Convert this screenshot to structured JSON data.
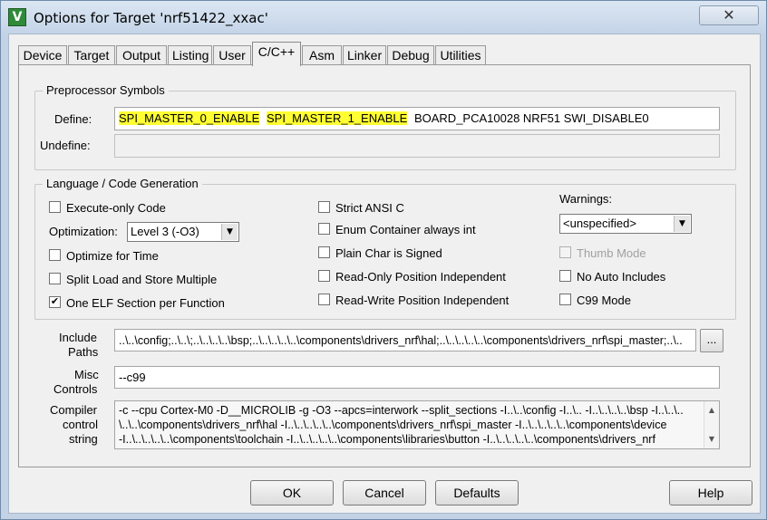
{
  "window": {
    "title": "Options for Target 'nrf51422_xxac'",
    "close_glyph": "✕",
    "icon_glyph": "V"
  },
  "tabs": [
    "Device",
    "Target",
    "Output",
    "Listing",
    "User",
    "C/C++",
    "Asm",
    "Linker",
    "Debug",
    "Utilities"
  ],
  "preprocessor": {
    "title": "Preprocessor Symbols",
    "define_label": "Define:",
    "define_highlight_1": "SPI_MASTER_0_ENABLE",
    "define_highlight_2": "SPI_MASTER_1_ENABLE",
    "define_rest": "BOARD_PCA10028 NRF51 SWI_DISABLE0",
    "undefine_label": "Undefine:",
    "undefine_value": ""
  },
  "language": {
    "title": "Language / Code Generation",
    "execute_only": "Execute-only Code",
    "optimization_label": "Optimization:",
    "optimization_value": "Level 3 (-O3)",
    "optimize_time": "Optimize for Time",
    "split_load": "Split Load and Store Multiple",
    "one_elf": "One ELF Section per Function",
    "strict_ansi": "Strict ANSI C",
    "enum_container": "Enum Container always int",
    "plain_char": "Plain Char is Signed",
    "ro_pi": "Read-Only Position Independent",
    "rw_pi": "Read-Write Position Independent",
    "warnings_label": "Warnings:",
    "warnings_value": "<unspecified>",
    "thumb_mode": "Thumb Mode",
    "no_auto_includes": "No Auto Includes",
    "c99_mode": "C99 Mode",
    "check_glyph": "✔"
  },
  "paths": {
    "include_label_1": "Include",
    "include_label_2": "Paths",
    "include_value": "..\\..\\config;..\\..\\;..\\..\\..\\..\\bsp;..\\..\\..\\..\\..\\components\\drivers_nrf\\hal;..\\..\\..\\..\\..\\components\\drivers_nrf\\spi_master;..\\..",
    "browse_label": "...",
    "misc_label_1": "Misc",
    "misc_label_2": "Controls",
    "misc_value": "--c99",
    "compiler_label_1": "Compiler",
    "compiler_label_2": "control",
    "compiler_label_3": "string",
    "compiler_lines": [
      "-c --cpu Cortex-M0 -D__MICROLIB -g -O3 --apcs=interwork --split_sections -I..\\..\\config -I..\\.. -I..\\..\\..\\..\\bsp -I..\\..\\..",
      "\\..\\..\\components\\drivers_nrf\\hal -I..\\..\\..\\..\\..\\components\\drivers_nrf\\spi_master -I..\\..\\..\\..\\..\\components\\device",
      "-I..\\..\\..\\..\\..\\components\\toolchain -I..\\..\\..\\..\\..\\components\\libraries\\button -I..\\..\\..\\..\\..\\components\\drivers_nrf"
    ]
  },
  "buttons": {
    "ok": "OK",
    "cancel": "Cancel",
    "defaults": "Defaults",
    "help": "Help"
  }
}
